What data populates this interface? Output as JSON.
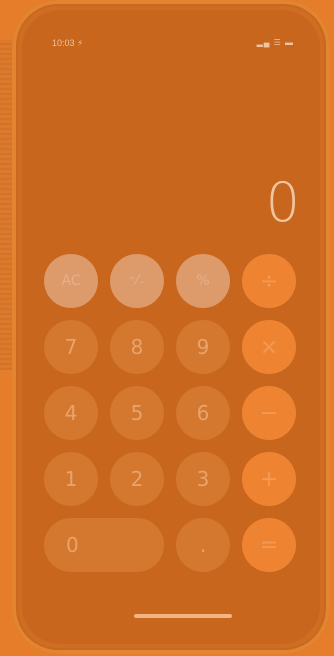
{
  "status_bar": {
    "time": "10:03 ⚡",
    "icons": "▂▄ ☰ ▬"
  },
  "display": {
    "value": "0"
  },
  "keys": {
    "ac": "AC",
    "plus_minus": "⁺⁄₋",
    "percent": "%",
    "divide": "÷",
    "seven": "7",
    "eight": "8",
    "nine": "9",
    "multiply": "×",
    "four": "4",
    "five": "5",
    "six": "6",
    "minus": "−",
    "one": "1",
    "two": "2",
    "three": "3",
    "plus": "+",
    "zero": "0",
    "decimal": ".",
    "equals": "="
  },
  "colors": {
    "background": "#e67d2a",
    "digit_key": "#d4782f",
    "function_key": "#dd9a6a",
    "operator_key": "#ee8431"
  }
}
